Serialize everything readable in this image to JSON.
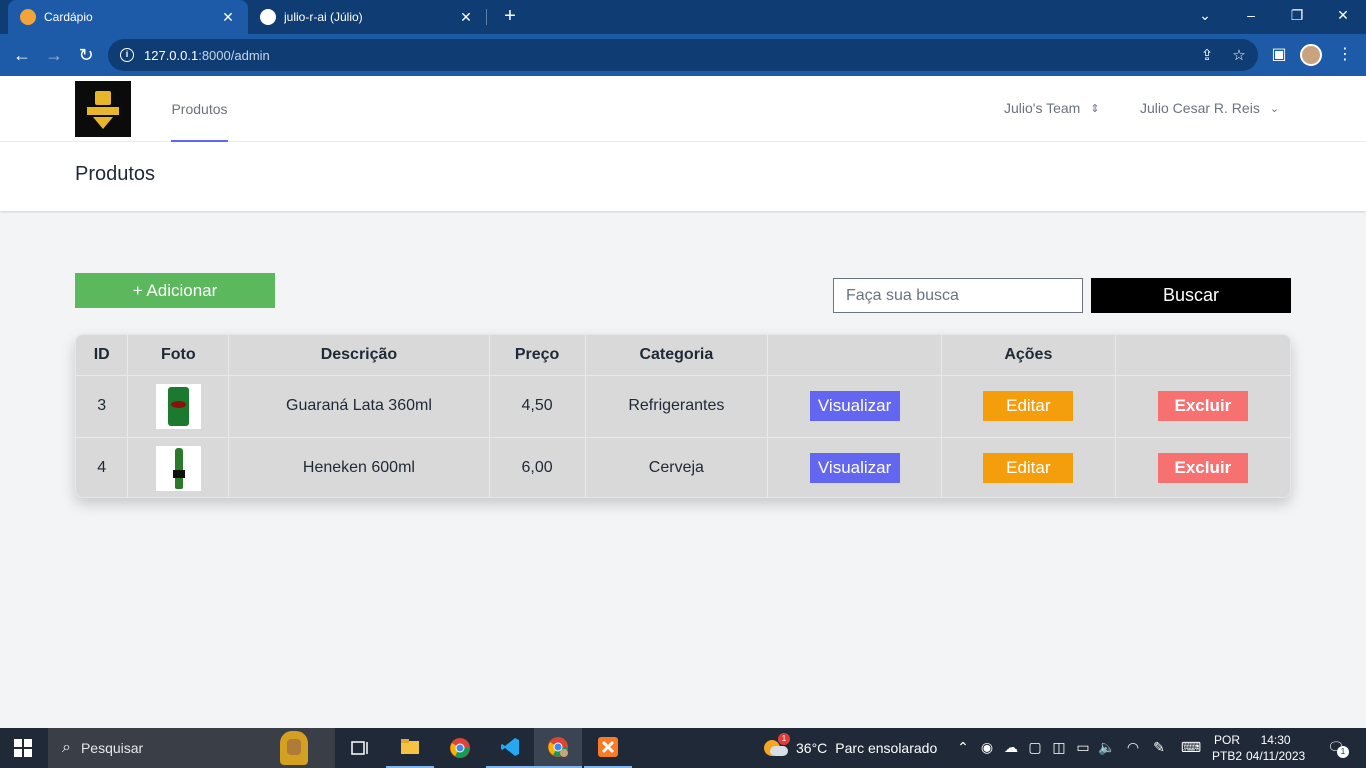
{
  "browser": {
    "tabs": [
      {
        "title": "Cardápio",
        "active": true
      },
      {
        "title": "julio-r-ai (Júlio)",
        "active": false
      }
    ],
    "url_host": "127.0.0.1",
    "url_path": ":8000/admin"
  },
  "app": {
    "nav_link": "Produtos",
    "team": "Julio's Team",
    "user": "Julio Cesar R. Reis",
    "page_title": "Produtos"
  },
  "toolbar": {
    "add_label": "+ Adicionar",
    "search_placeholder": "Faça sua busca",
    "search_button": "Buscar"
  },
  "table": {
    "headers": [
      "ID",
      "Foto",
      "Descrição",
      "Preço",
      "Categoria",
      "",
      "Ações",
      ""
    ],
    "rows": [
      {
        "id": "3",
        "photo_icon": "soda-can-icon",
        "description": "Guaraná Lata 360ml",
        "price": "4,50",
        "category": "Refrigerantes",
        "view": "Visualizar",
        "edit": "Editar",
        "delete": "Excluir"
      },
      {
        "id": "4",
        "photo_icon": "beer-bottle-icon",
        "description": "Heneken 600ml",
        "price": "6,00",
        "category": "Cerveja",
        "view": "Visualizar",
        "edit": "Editar",
        "delete": "Excluir"
      }
    ]
  },
  "taskbar": {
    "search_placeholder": "Pesquisar",
    "weather_temp": "36°C",
    "weather_text": "Parc ensolarado",
    "weather_badge": "1",
    "lang_line1": "POR",
    "lang_line2": "PTB2",
    "time": "14:30",
    "date": "04/11/2023",
    "notification_count": "1"
  },
  "colors": {
    "add_button": "#5cb85c",
    "view_button": "#6366f1",
    "edit_button": "#f59e0b",
    "delete_button": "#f87171",
    "browser_frame": "#0f3c73"
  }
}
